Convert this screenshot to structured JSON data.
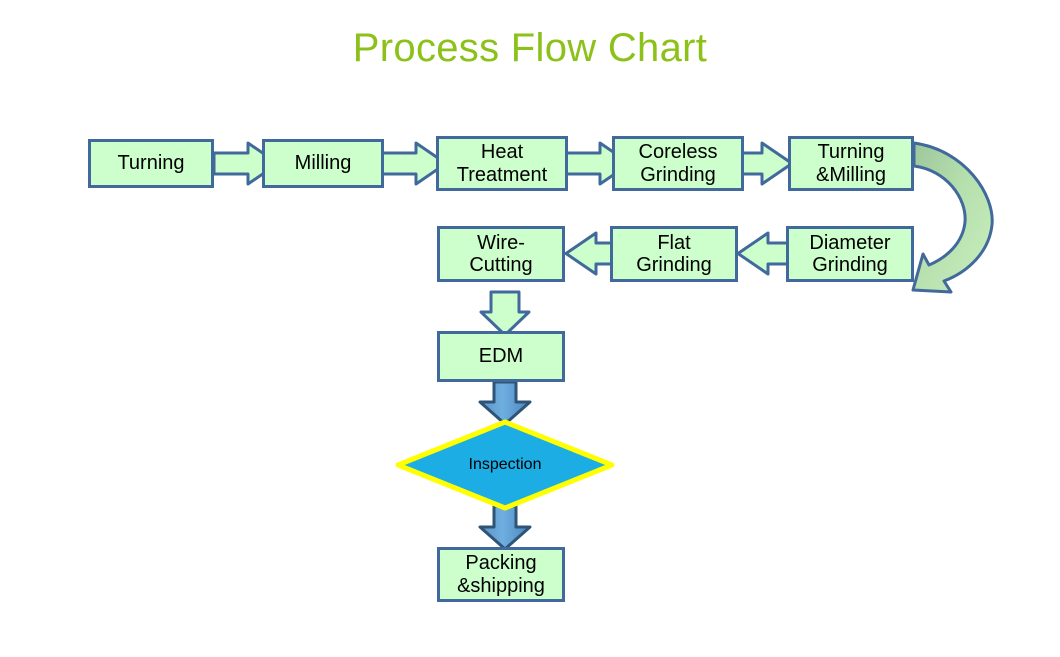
{
  "title": "Process Flow Chart",
  "theme": {
    "title_color": "#8CC11A",
    "box_fill": "#CCFFCC",
    "box_border": "#41699B",
    "arrow_fill": "#CCFFCC",
    "arrow_border": "#41699B",
    "solid_arrow_fill": "#5B9BD5",
    "solid_arrow_border": "#2E5478",
    "decision_fill": "#1CADE4",
    "decision_border": "#FFFF00",
    "background": "#FFFFFF"
  },
  "nodes": [
    {
      "id": "turning",
      "label": "Turning"
    },
    {
      "id": "milling",
      "label": "Milling"
    },
    {
      "id": "heat-treatment",
      "label": "Heat\nTreatment"
    },
    {
      "id": "coreless-grinding",
      "label": "Coreless\nGrinding"
    },
    {
      "id": "turning-milling",
      "label": "Turning\n&Milling"
    },
    {
      "id": "diameter-grinding",
      "label": "Diameter\nGrinding"
    },
    {
      "id": "flat-grinding",
      "label": "Flat\nGrinding"
    },
    {
      "id": "wire-cutting",
      "label": "Wire-\nCutting"
    },
    {
      "id": "edm",
      "label": "EDM"
    },
    {
      "id": "packing-shipping",
      "label": "Packing\n&shipping"
    }
  ],
  "decision": {
    "id": "inspection",
    "label": "Inspection"
  },
  "connectors": [
    {
      "id": "turning-to-milling",
      "type": "block-arrow",
      "direction": "right"
    },
    {
      "id": "milling-to-heat-treatment",
      "type": "block-arrow",
      "direction": "right"
    },
    {
      "id": "heat-treatment-to-coreless-grinding",
      "type": "block-arrow",
      "direction": "right"
    },
    {
      "id": "coreless-grinding-to-turning-milling",
      "type": "block-arrow",
      "direction": "right"
    },
    {
      "id": "turning-milling-to-diameter-grinding",
      "type": "curved-arrow",
      "direction": "down-left"
    },
    {
      "id": "diameter-grinding-to-flat-grinding",
      "type": "block-arrow",
      "direction": "left"
    },
    {
      "id": "flat-grinding-to-wire-cutting",
      "type": "block-arrow",
      "direction": "left"
    },
    {
      "id": "wire-cutting-to-edm",
      "type": "block-arrow",
      "direction": "down"
    },
    {
      "id": "edm-to-inspection",
      "type": "solid-arrow",
      "direction": "down"
    },
    {
      "id": "inspection-to-packing-shipping",
      "type": "solid-arrow",
      "direction": "down"
    }
  ]
}
